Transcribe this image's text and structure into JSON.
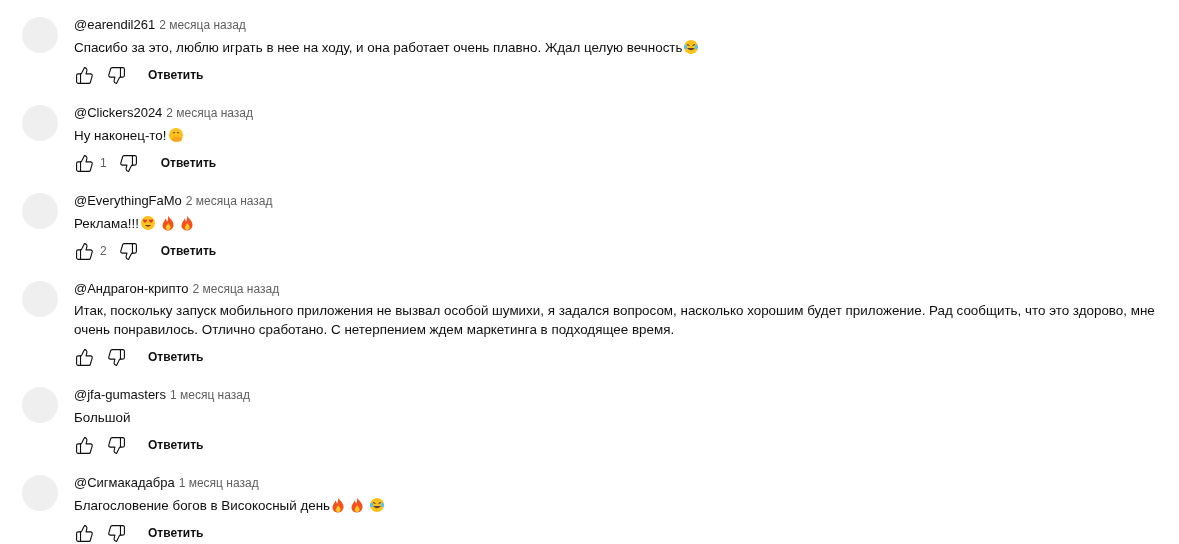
{
  "comments": [
    {
      "author": "@earendil261",
      "time": "2 месяца назад",
      "text": "Спасибо за это, люблю играть в нее на ходу, и она работает очень плавно. Ждал целую вечность",
      "emoji": [
        {
          "kind": "laughing"
        }
      ],
      "reply": "Ответить"
    },
    {
      "author": "@Clickers2024",
      "time": "2 месяца назад",
      "text": "Ну наконец-то!",
      "emoji": [
        {
          "kind": "face-with-hand"
        }
      ],
      "likes": "1",
      "reply": "Ответить"
    },
    {
      "author": "@EverythingFaMo",
      "time": "2 месяца назад",
      "text": "Реклама!!!",
      "emoji": [
        {
          "kind": "heart-eyes"
        },
        {
          "kind": "fire"
        },
        {
          "kind": "fire"
        }
      ],
      "likes": "2",
      "reply": "Ответить"
    },
    {
      "author": "@Андрагон-крипто",
      "time": "2 месяца назад",
      "text": "Итак, поскольку запуск мобильного приложения не вызвал особой шумихи, я задался вопросом, насколько хорошим будет приложение. Рад сообщить, что это здорово, мне очень понравилось. Отлично сработано. С нетерпением ждем маркетинга в подходящее время.",
      "reply": "Ответить"
    },
    {
      "author": "@jfa-gumasters",
      "time": "1 месяц назад",
      "text": "Большой",
      "reply": "Ответить"
    },
    {
      "author": "@Сигмакадабра",
      "time": "1 месяц назад",
      "text": "Благословение богов в Високосный день",
      "emoji": [
        {
          "kind": "fire"
        },
        {
          "kind": "fire"
        },
        {
          "kind": "laughing"
        }
      ],
      "reply": "Ответить"
    }
  ]
}
